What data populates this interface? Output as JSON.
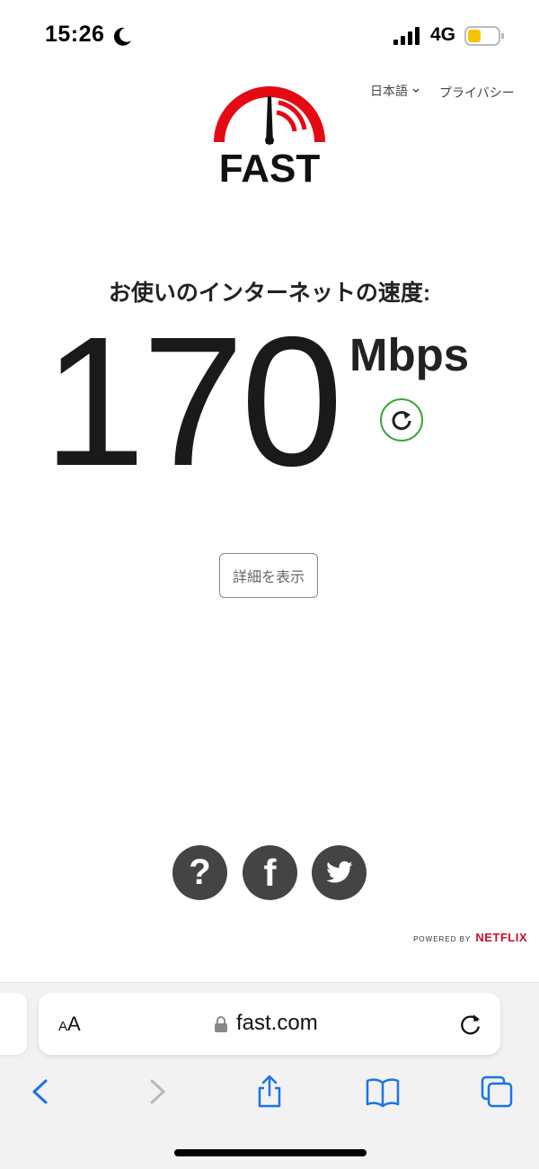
{
  "status_bar": {
    "time": "15:26",
    "network": "4G",
    "battery_color": "#f5c400"
  },
  "header": {
    "language": "日本語",
    "privacy": "プライバシー",
    "logo_text": "FAST",
    "logo_color": "#e50914"
  },
  "speed": {
    "heading": "お使いのインターネットの速度:",
    "value": "170",
    "unit": "Mbps",
    "reload_color": "#3aa83a"
  },
  "details_button": "詳細を表示",
  "footer": {
    "social_icons": [
      "help-icon",
      "facebook-icon",
      "twitter-icon"
    ],
    "help_glyph": "?",
    "facebook_glyph": "f",
    "powered_by": "POWERED BY",
    "netflix": "NETFLIX"
  },
  "browser": {
    "text_size_small": "A",
    "text_size_large": "A",
    "url": "fast.com",
    "accent_color": "#1a73e8"
  }
}
